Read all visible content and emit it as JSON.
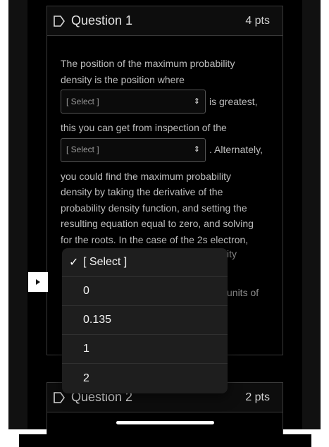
{
  "question1": {
    "title": "Question 1",
    "points": "4 pts",
    "text_lines_1": [
      "The position of the maximum probability",
      "density is the position where"
    ],
    "select1_placeholder": "[ Select ]",
    "after_select1": "is greatest,",
    "text_line_2": "this you can get from inspection of the",
    "select2_placeholder": "[ Select ]",
    "after_select2": ". Alternately,",
    "text_lines_3": [
      "you could find the maximum probability",
      "density by taking the derivative of the",
      "probability density function, and setting the",
      "resulting equation equal to zero, and solving",
      "for the roots. In the case of the 2s electron,"
    ],
    "partial_right_1": "ity",
    "partial_right_2": "units of"
  },
  "dropdown": {
    "options": [
      "[ Select ]",
      "0",
      "0.135",
      "1",
      "2"
    ],
    "selected": "[ Select ]"
  },
  "question2": {
    "title": "Question 2",
    "points": "2 pts"
  },
  "icons": {
    "flag": "flag-outline-icon",
    "side_tab": "play-triangle-icon",
    "select_arrow": "up-down-chevron-icon",
    "check": "checkmark-icon"
  }
}
